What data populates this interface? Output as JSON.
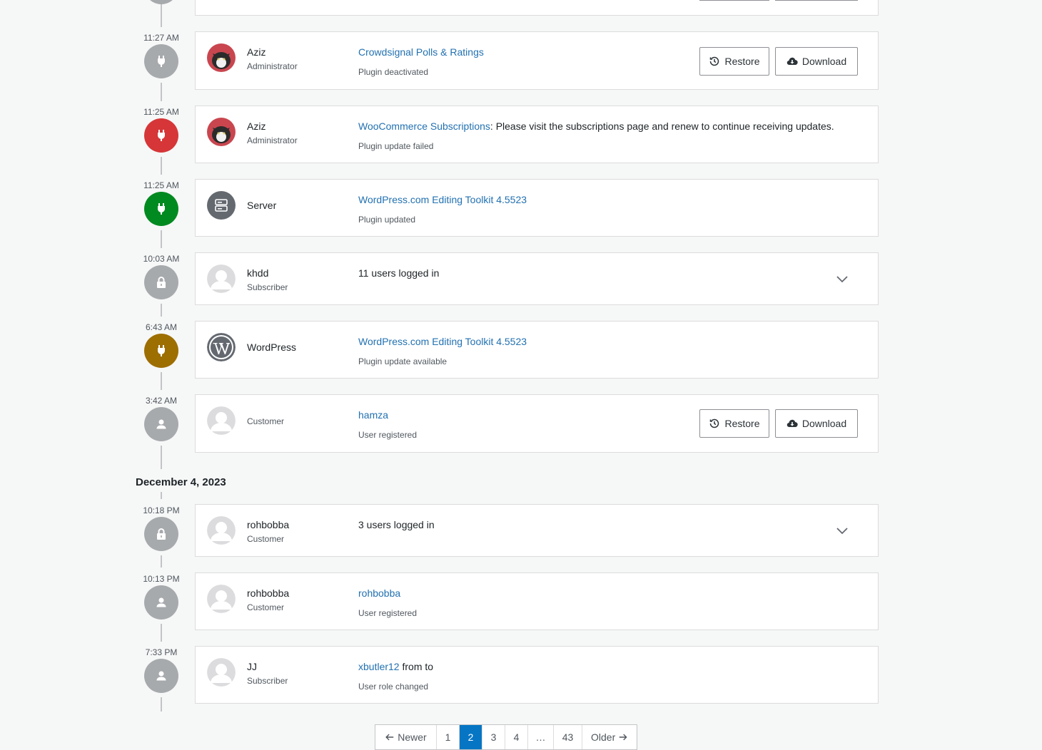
{
  "colors": {
    "accent": "#2271b1",
    "gray_event": "#a7aaad",
    "error": "#d63638",
    "success": "#008a20",
    "warning": "#9d6e00",
    "pagination_active": "#0675c4"
  },
  "buttons": {
    "restore": "Restore",
    "download": "Download"
  },
  "events": [
    {
      "time": "11:27 AM",
      "icon": "plug-icon",
      "color": "gray",
      "actor": "Aziz",
      "role": "Administrator",
      "avatar": "cat-photo",
      "link": "Crowdsignal Polls & Ratings",
      "text": "",
      "subtitle": "Plugin deactivated",
      "actions": [
        "restore",
        "download"
      ]
    },
    {
      "time": "11:25 AM",
      "icon": "plug-icon",
      "color": "red",
      "actor": "Aziz",
      "role": "Administrator",
      "avatar": "cat-photo",
      "link": "WooCommerce Subscriptions",
      "text": ": Please visit the subscriptions page and renew to continue receiving updates.",
      "subtitle": "Plugin update failed"
    },
    {
      "time": "11:25 AM",
      "icon": "plug-icon",
      "color": "green",
      "actor": "Server",
      "role": "",
      "avatar": "server-icon",
      "link": "WordPress.com Editing Toolkit 4.5523",
      "text": "",
      "subtitle": "Plugin updated"
    },
    {
      "time": "10:03 AM",
      "icon": "lock-icon",
      "color": "gray",
      "actor": "khdd",
      "role": "Subscriber",
      "avatar": "default-avatar",
      "link": "",
      "text": "11 users logged in",
      "subtitle": "",
      "expandable": true
    },
    {
      "time": "6:43 AM",
      "icon": "plug-icon",
      "color": "yellow",
      "actor": "WordPress",
      "role": "",
      "avatar": "wordpress-logo",
      "link": "WordPress.com Editing Toolkit 4.5523",
      "text": "",
      "subtitle": "Plugin update available"
    },
    {
      "time": "3:42 AM",
      "icon": "user-icon",
      "color": "gray",
      "actor": "",
      "role": "Customer",
      "avatar": "default-avatar",
      "link": "hamza",
      "text": "",
      "subtitle": "User registered",
      "actions": [
        "restore",
        "download"
      ]
    }
  ],
  "date_heading": "December 4, 2023",
  "events2": [
    {
      "time": "10:18 PM",
      "icon": "lock-icon",
      "color": "gray",
      "actor": "rohbobba",
      "role": "Customer",
      "avatar": "default-avatar",
      "link": "",
      "text": "3 users logged in",
      "subtitle": "",
      "expandable": true
    },
    {
      "time": "10:13 PM",
      "icon": "user-icon",
      "color": "gray",
      "actor": "rohbobba",
      "role": "Customer",
      "avatar": "default-avatar",
      "link": "rohbobba",
      "text": "",
      "subtitle": "User registered"
    },
    {
      "time": "7:33 PM",
      "icon": "user-icon",
      "color": "gray",
      "actor": "JJ",
      "role": "Subscriber",
      "avatar": "default-avatar",
      "link": "xbutler12",
      "text": " from to",
      "subtitle": "User role changed"
    }
  ],
  "pagination": {
    "newer": "Newer",
    "pages": [
      "1",
      "2",
      "3",
      "4",
      "…",
      "43"
    ],
    "current": "2",
    "older": "Older"
  }
}
